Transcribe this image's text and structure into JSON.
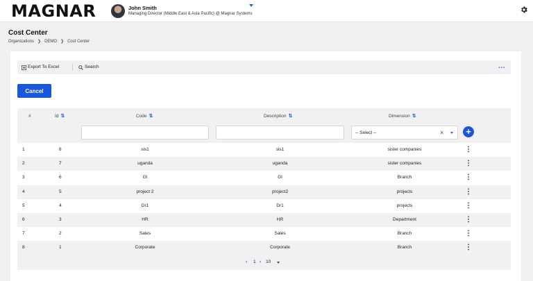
{
  "header": {
    "logo": "MAGNAR",
    "user_name": "John Smith",
    "user_role": "Managing Director (Middle East & Asia Pacific) @ Magnar Systems"
  },
  "page": {
    "title": "Cost Center",
    "breadcrumb": [
      "Organizations",
      "DEMO",
      "Cost Center"
    ]
  },
  "toolbar": {
    "export_label": "Export To Excel",
    "search_label": "Search",
    "more_label": "..."
  },
  "cancel_label": "Cancel",
  "table": {
    "columns": {
      "index": "#",
      "id": "Id",
      "code": "Code",
      "description": "Description",
      "dimension": "Dimension"
    },
    "sort_glyph": "⇅",
    "dimension_filter": "-- Select --",
    "rows": [
      {
        "index": "1",
        "id": "8",
        "code": "sis1",
        "description": "sis1",
        "dimension": "sister companies"
      },
      {
        "index": "2",
        "id": "7",
        "code": "uganda",
        "description": "uganda",
        "dimension": "sister companies"
      },
      {
        "index": "3",
        "id": "6",
        "code": "GI",
        "description": "GI",
        "dimension": "Branch"
      },
      {
        "index": "4",
        "id": "5",
        "code": "project 2",
        "description": "project2",
        "dimension": "projects"
      },
      {
        "index": "5",
        "id": "4",
        "code": "Dr1",
        "description": "Dr1",
        "dimension": "projects"
      },
      {
        "index": "6",
        "id": "3",
        "code": "HR",
        "description": "HR",
        "dimension": "Department"
      },
      {
        "index": "7",
        "id": "2",
        "code": "Sales",
        "description": "Sales",
        "dimension": "Branch"
      },
      {
        "index": "8",
        "id": "1",
        "code": "Corporate",
        "description": "Corporate",
        "dimension": "Branch"
      }
    ]
  },
  "pager": {
    "prev": "‹",
    "page": "1",
    "next": "›",
    "page_size": "10"
  },
  "colors": {
    "accent": "#1a56db",
    "toolbar_bg": "#f1f1f3",
    "page_bg": "#f0f0f1"
  },
  "icons": {
    "settings": "gear-icon",
    "export": "excel-icon",
    "search": "search-icon",
    "add": "plus-icon",
    "row_menu": "kebab-icon"
  }
}
